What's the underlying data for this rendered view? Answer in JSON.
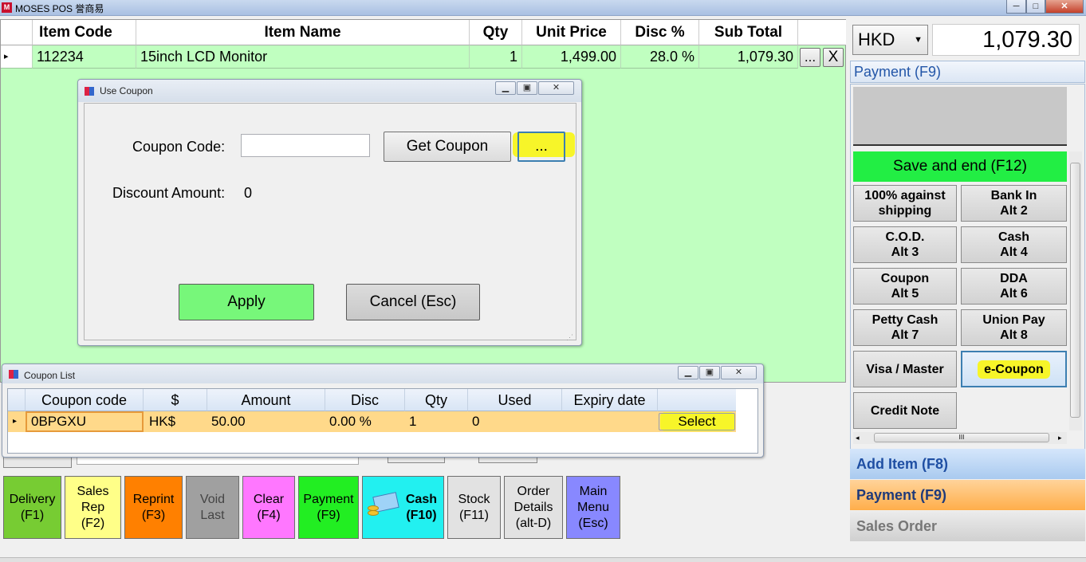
{
  "window": {
    "title": "MOSES POS 誉商易",
    "app_icon_text": "M",
    "controls": [
      "─",
      "□",
      "✕"
    ]
  },
  "grid": {
    "columns": [
      "Item Code",
      "Item Name",
      "Qty",
      "Unit Price",
      "Disc %",
      "Sub Total"
    ],
    "rows": [
      {
        "marker": "▸",
        "item_code": "112234",
        "item_name": "15inch LCD Monitor",
        "qty": "1",
        "unit_price": "1,499.00",
        "disc": "28.0 %",
        "sub_total": "1,079.30",
        "more": "...",
        "remove": "X"
      }
    ]
  },
  "use_coupon": {
    "title": "Use Coupon",
    "coupon_code_label": "Coupon Code:",
    "coupon_code_value": "",
    "get_coupon": "Get Coupon",
    "browse": "...",
    "discount_label": "Discount Amount:",
    "discount_value": "0",
    "apply": "Apply",
    "cancel": "Cancel (Esc)"
  },
  "coupon_list": {
    "title": "Coupon List",
    "columns": [
      "Coupon code",
      "$",
      "Amount",
      "Disc",
      "Qty",
      "Used",
      "Expiry date"
    ],
    "rows": [
      {
        "marker": "▸",
        "code": "0BPGXU",
        "currency": "HK$",
        "amount": "50.00",
        "disc": "0.00 %",
        "qty": "1",
        "used": "0",
        "expiry": "",
        "select": "Select"
      }
    ]
  },
  "right_panel": {
    "currency": "HKD",
    "total": "1,079.30",
    "payment_header": "Payment (F9)",
    "save_end": "Save and end (F12)",
    "methods": [
      "100% against\nshipping",
      "Bank In\nAlt 2",
      "C.O.D.\nAlt 3",
      "Cash\nAlt 4",
      "Coupon\nAlt 5",
      "DDA\nAlt 6",
      "Petty Cash\nAlt 7",
      "Union Pay\nAlt 8",
      "Visa / Master",
      "e-Coupon",
      "Credit Note"
    ],
    "scroll_grip": "III",
    "add_item": "Add Item (F8)",
    "payment": "Payment (F9)",
    "sales_order": "Sales Order"
  },
  "bottom_bar": {
    "buttons": [
      "Delivery\n(F1)",
      "Sales\nRep\n(F2)",
      "Reprint\n(F3)",
      "Void\nLast",
      "Clear\n(F4)",
      "Payment\n(F9)",
      "Cash\n(F10)",
      "Stock\n(F11)",
      "Order\nDetails\n(alt-D)",
      "Main\nMenu\n(Esc)"
    ]
  },
  "colors": {
    "grid_bg": "#c0ffc0",
    "save_end": "#22ee44",
    "highlight": "#f7f529",
    "selected_row": "#ffd98a"
  }
}
